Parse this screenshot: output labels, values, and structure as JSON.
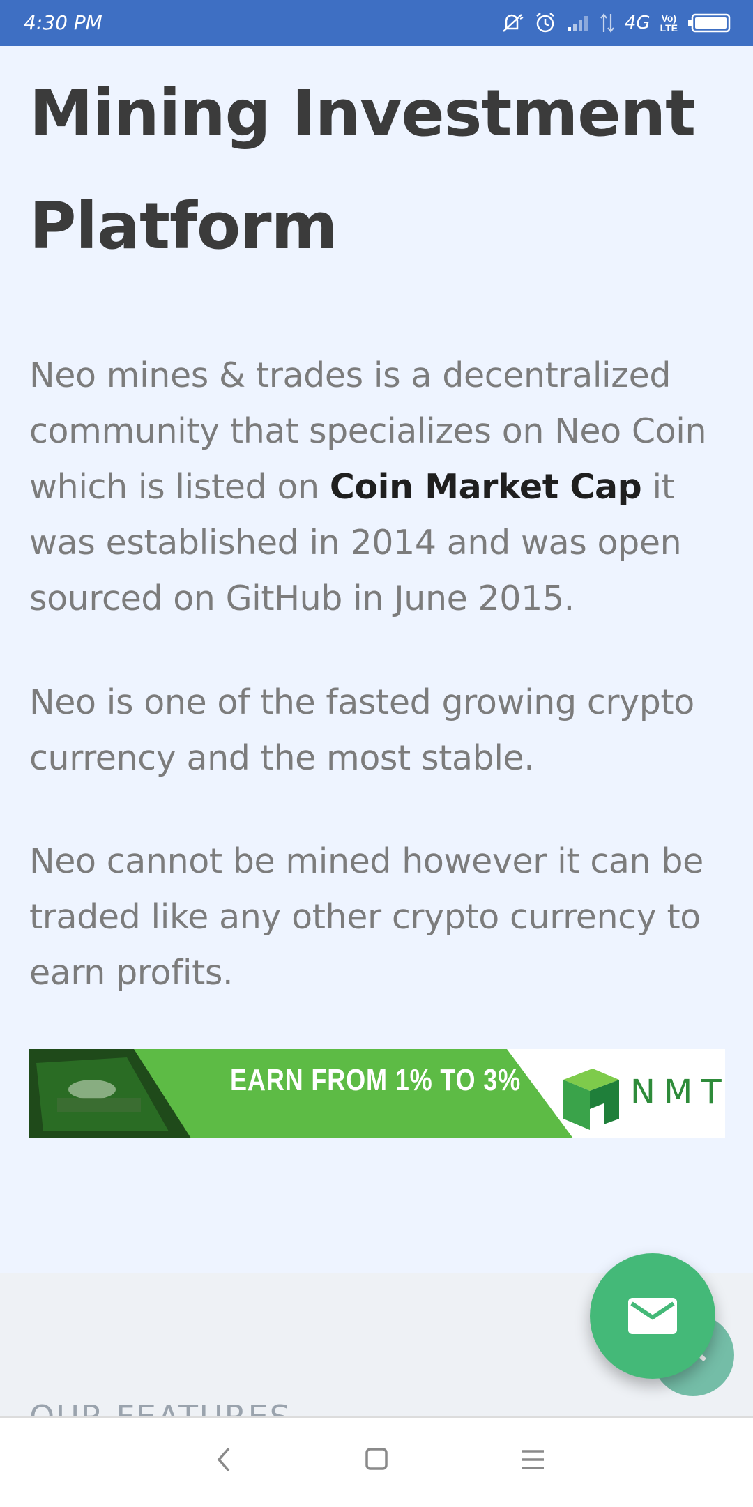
{
  "status_bar": {
    "time": "4:30 PM",
    "network": "4G",
    "volte_top": "Vo)",
    "volte_bottom": "LTE",
    "icons": [
      "mute-icon",
      "alarm-icon",
      "signal-icon",
      "data-arrows-icon",
      "battery-icon"
    ]
  },
  "page": {
    "title": "Mining Investment Platform",
    "paragraph1": {
      "before": "Neo mines & trades is a decentralized community that specializes on Neo Coin which is listed on ",
      "link": "Coin Market Cap",
      "after": " it was established in 2014 and was open sourced on GitHub in June 2015."
    },
    "paragraph2": "Neo is one of the fasted growing crypto currency and the most stable.",
    "paragraph3": "Neo cannot be mined however it can be traded like any other crypto currency to earn profits."
  },
  "banner": {
    "headline": "EARN FROM 1% TO 3%",
    "brand": "NMT",
    "colors": {
      "green": "#5dbb45",
      "dark_green": "#2e8b3a"
    }
  },
  "features": {
    "label": "OUR FEATURES"
  },
  "floating": {
    "mail_icon": "mail-icon",
    "scroll_icon": "chevron-up-icon",
    "mail_color": "#44b978"
  },
  "nav": {
    "back_icon": "back-icon",
    "home_icon": "home-icon",
    "menu_icon": "menu-icon"
  }
}
